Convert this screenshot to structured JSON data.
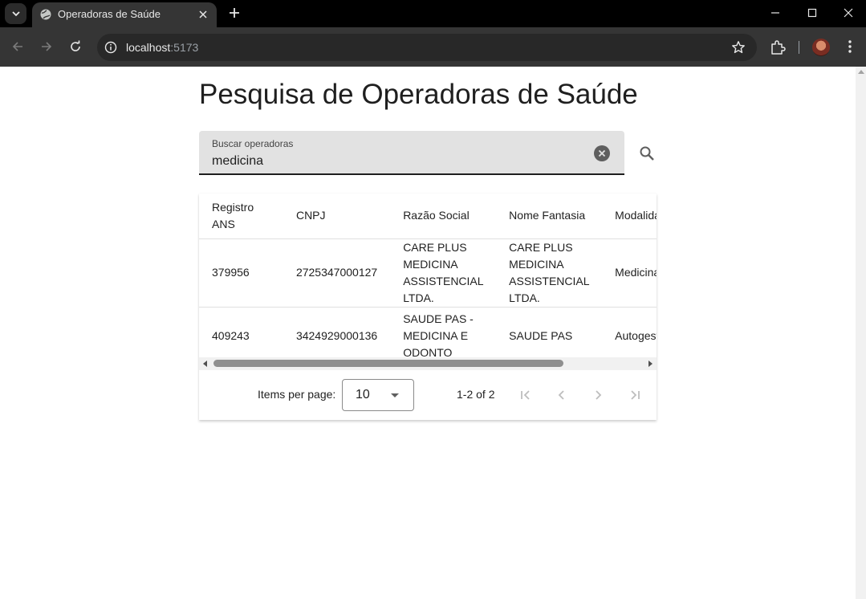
{
  "browser": {
    "tab_title": "Operadoras de Saúde",
    "url_host": "localhost",
    "url_port": ":5173"
  },
  "page": {
    "title": "Pesquisa de Operadoras de Saúde"
  },
  "search": {
    "label": "Buscar operadoras",
    "value": "medicina"
  },
  "table": {
    "headers": {
      "registro": "Registro ANS",
      "cnpj": "CNPJ",
      "razao": "Razão Social",
      "fantasia": "Nome Fantasia",
      "modalidade": "Modalidade"
    },
    "rows": [
      {
        "registro": "379956",
        "cnpj": "2725347000127",
        "razao": "CARE PLUS MEDICINA ASSISTENCIAL LTDA.",
        "fantasia": "CARE PLUS MEDICINA ASSISTENCIAL LTDA.",
        "modalidade": "Medicina de Grupo"
      },
      {
        "registro": "409243",
        "cnpj": "3424929000136",
        "razao": "SAUDE PAS - MEDICINA E ODONTO",
        "fantasia": "SAUDE PAS",
        "modalidade": "Autogestão"
      }
    ]
  },
  "paginator": {
    "items_per_page_label": "Items per page:",
    "page_size": "10",
    "range_label": "1-2 of 2"
  },
  "icons": {
    "search": "search-icon",
    "clear": "clear-icon",
    "first_page": "first-page-icon",
    "prev_page": "chevron-left-icon",
    "next_page": "chevron-right-icon",
    "last_page": "last-page-icon"
  }
}
